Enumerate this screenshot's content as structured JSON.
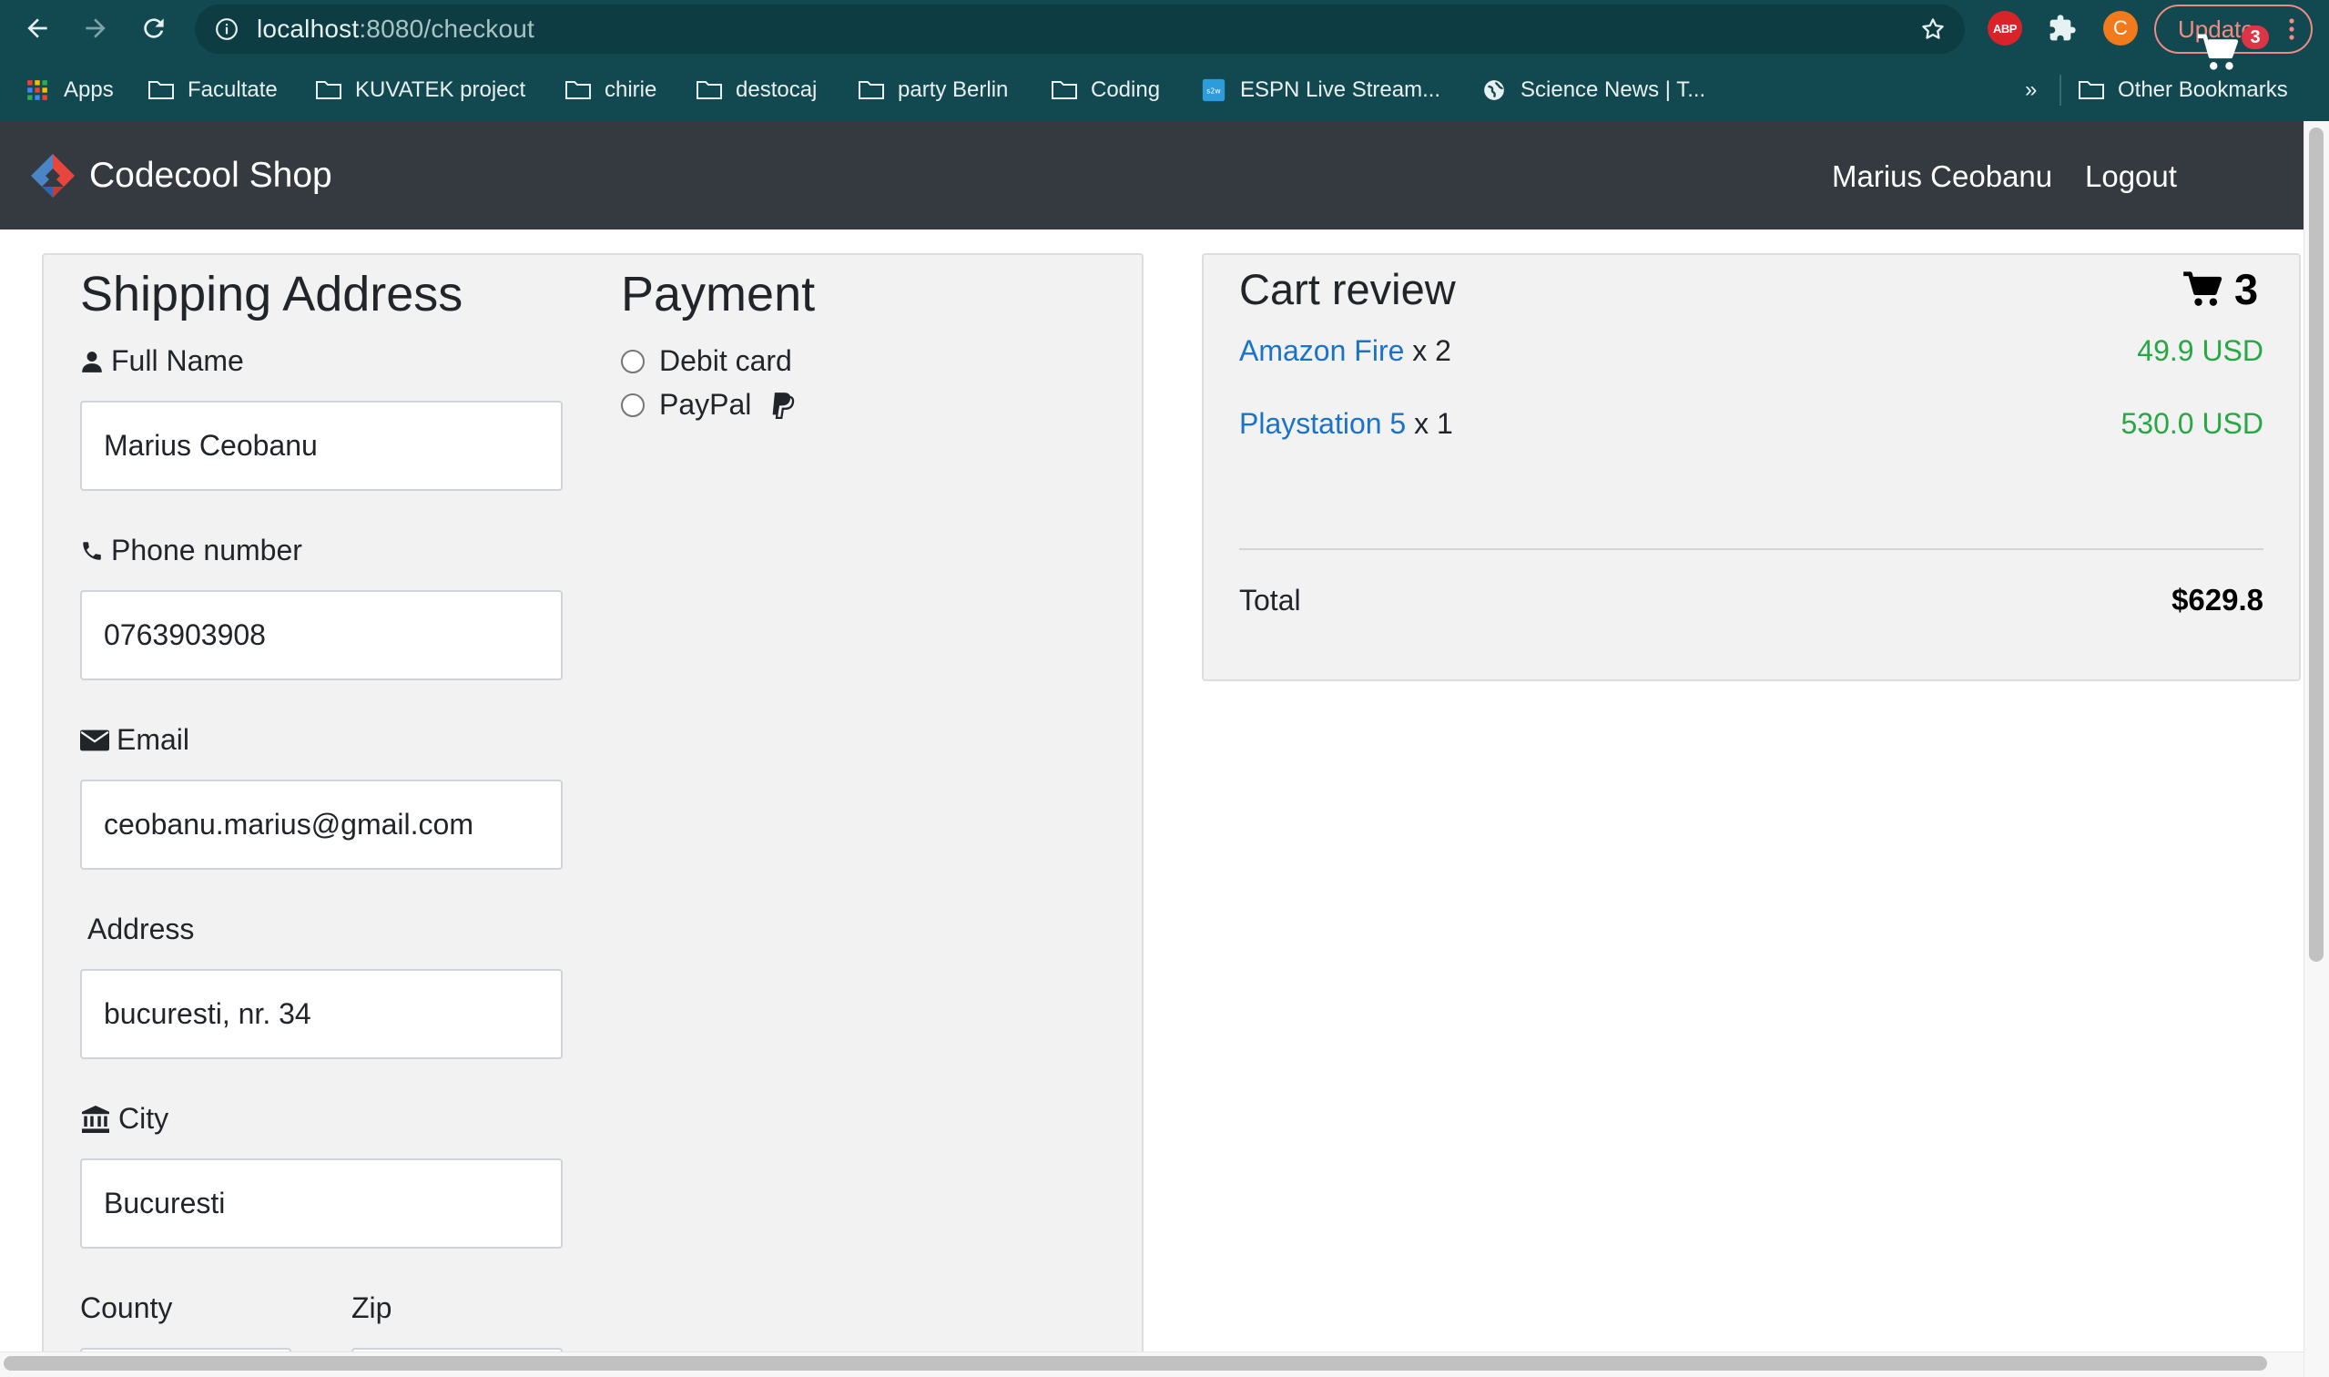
{
  "browser": {
    "url_host": "localhost",
    "url_path": ":8080/checkout",
    "abp_label": "ABP",
    "profile_initial": "C",
    "update_label": "Update",
    "bookmarks": [
      {
        "label": "Apps",
        "icon": "apps-grid-icon"
      },
      {
        "label": "Facultate",
        "icon": "folder-icon"
      },
      {
        "label": "KUVATEK project",
        "icon": "folder-icon"
      },
      {
        "label": "chirie",
        "icon": "folder-icon"
      },
      {
        "label": "destocaj",
        "icon": "folder-icon"
      },
      {
        "label": "party Berlin",
        "icon": "folder-icon"
      },
      {
        "label": "Coding",
        "icon": "folder-icon"
      },
      {
        "label": "ESPN Live Stream...",
        "icon": "s2w-site-icon"
      },
      {
        "label": "Science News | T...",
        "icon": "globe-icon"
      }
    ],
    "overflow_label": "»",
    "other_bookmarks": "Other Bookmarks",
    "s2w_label": "s2w"
  },
  "navbar": {
    "brand": "Codecool Shop",
    "user": "Marius Ceobanu",
    "logout": "Logout",
    "cart_badge": "3"
  },
  "shipping": {
    "title": "Shipping Address",
    "fields": [
      {
        "label": "Full Name",
        "value": "Marius Ceobanu",
        "icon": "user-icon"
      },
      {
        "label": "Phone number",
        "value": "0763903908",
        "icon": "phone-icon"
      },
      {
        "label": "Email",
        "value": "ceobanu.marius@gmail.com",
        "icon": "envelope-icon"
      },
      {
        "label": "Address",
        "value": "bucuresti, nr. 34",
        "icon": ""
      },
      {
        "label": "City",
        "value": "Bucuresti",
        "icon": "bank-icon"
      }
    ],
    "county_label": "County",
    "zip_label": "Zip"
  },
  "payment": {
    "title": "Payment",
    "options": [
      "Debit card",
      "PayPal"
    ]
  },
  "cart": {
    "title": "Cart review",
    "count": "3",
    "items": [
      {
        "name": "Amazon Fire",
        "qty": "x 2",
        "price": "49.9 USD"
      },
      {
        "name": "Playstation 5",
        "qty": "x 1",
        "price": "530.0 USD"
      }
    ],
    "total_label": "Total",
    "total_value": "$629.8"
  },
  "colors": {
    "chrome": "#124950",
    "navbar": "#343a40",
    "link": "#1a73c8",
    "price": "#28a745",
    "badge": "#dc3545"
  }
}
